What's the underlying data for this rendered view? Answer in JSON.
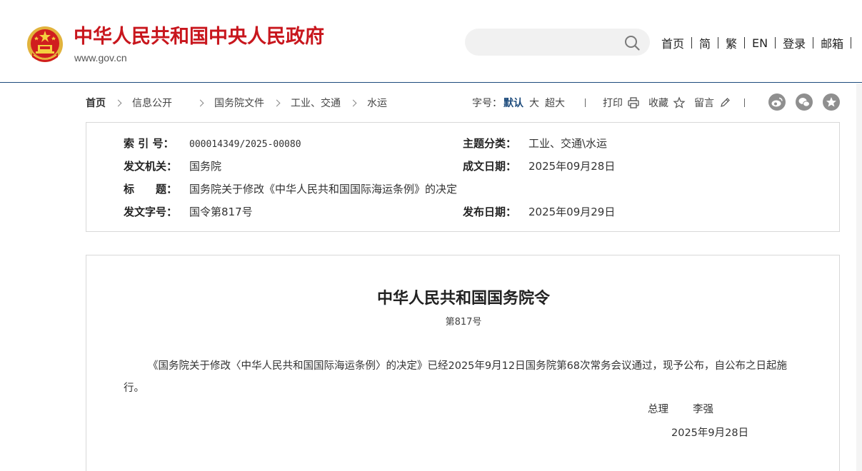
{
  "header": {
    "site_name": "中华人民共和国中央人民政府",
    "site_url": "www.gov.cn",
    "search_placeholder": "",
    "nav": [
      "首页",
      "简",
      "繁",
      "EN",
      "登录",
      "邮箱"
    ]
  },
  "breadcrumb": {
    "items": [
      "首页",
      "信息公开",
      "国务院文件",
      "工业、交通",
      "水运"
    ]
  },
  "tools": {
    "font_size_label": "字号：",
    "font_sizes": [
      "默认",
      "大",
      "超大"
    ],
    "print_label": "打印",
    "favorite_label": "收藏",
    "comment_label": "留言"
  },
  "meta": {
    "index_no_label": "索 引 号：",
    "index_no": "000014349/2025-00080",
    "topic_label": "主题分类：",
    "topic": "工业、交通\\水运",
    "issuer_label": "发文机关：",
    "issuer": "国务院",
    "written_date_label": "成文日期：",
    "written_date": "2025年09月28日",
    "title_label": "标　　题：",
    "title": "国务院关于修改《中华人民共和国国际海运条例》的决定",
    "doc_no_label": "发文字号：",
    "doc_no": "国令第817号",
    "publish_date_label": "发布日期：",
    "publish_date": "2025年09月29日"
  },
  "document": {
    "title": "中华人民共和国国务院令",
    "number": "第817号",
    "body": "《国务院关于修改〈中华人民共和国国际海运条例〉的决定》已经2025年9月12日国务院第68次常务会议通过，现予公布，自公布之日起施行。",
    "sign_title": "总理",
    "sign_name": "李强",
    "sign_date": "2025年9月28日"
  },
  "colors": {
    "brand_red": "#c8161d",
    "accent_blue": "#1d4b7c"
  }
}
